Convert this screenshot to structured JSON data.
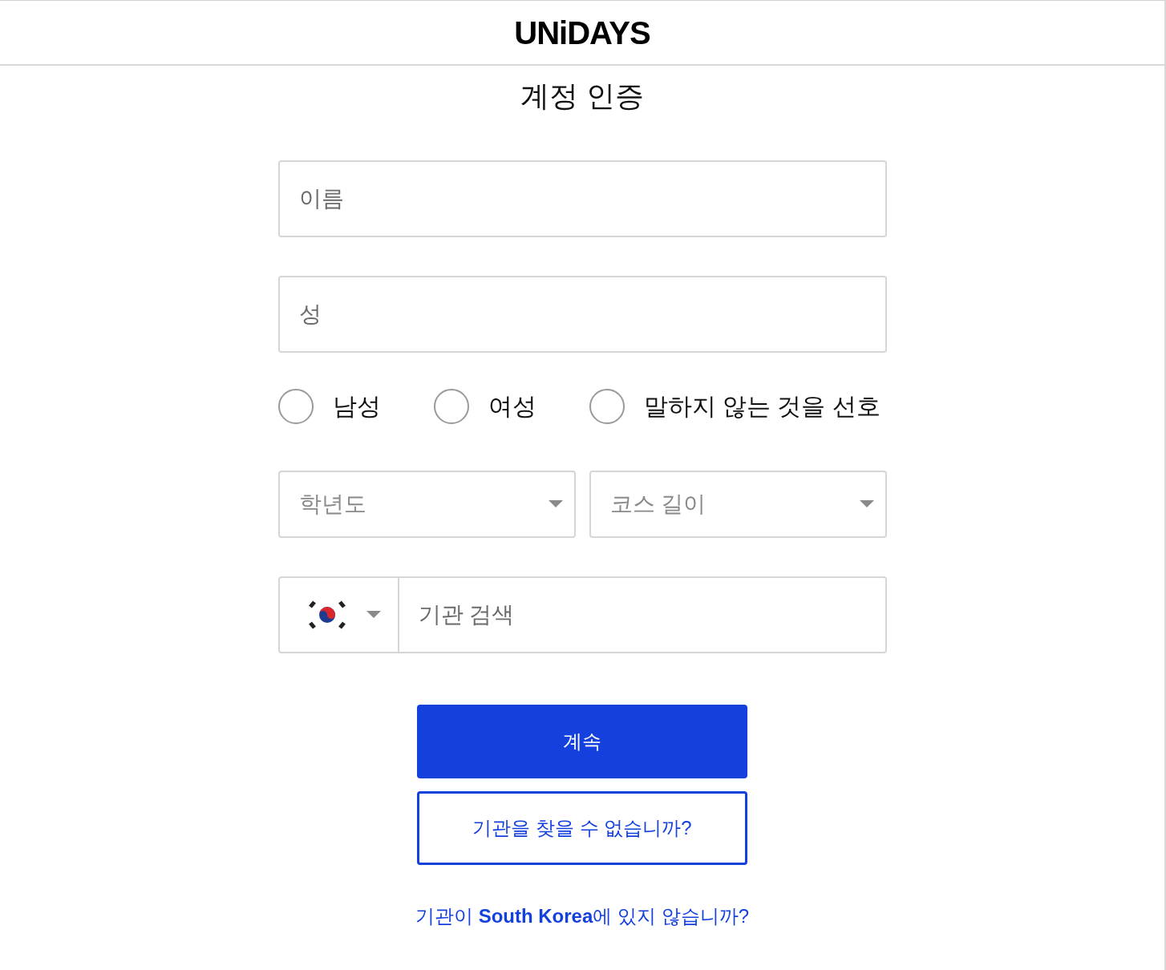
{
  "header": {
    "logo": "UNiDAYS"
  },
  "title": "계정 인증",
  "fields": [
    {
      "placeholder": "이름"
    },
    {
      "placeholder": "성"
    }
  ],
  "gender_options": [
    {
      "label": "남성",
      "selected": false
    },
    {
      "label": "여성",
      "selected": false
    },
    {
      "label": "말하지 않는 것을 선호",
      "selected": false
    }
  ],
  "dropdowns": [
    {
      "placeholder": "학년도"
    },
    {
      "placeholder": "코스 길이"
    }
  ],
  "institution_search": {
    "placeholder": "기관 검색"
  },
  "buttons": [
    {
      "label": "계속",
      "kind": "primary"
    },
    {
      "label": "기관을 찾을 수 없습니까?",
      "kind": "outline"
    }
  ],
  "footer_link": "기관이 **South Korea**에 있지 않습니까?"
}
